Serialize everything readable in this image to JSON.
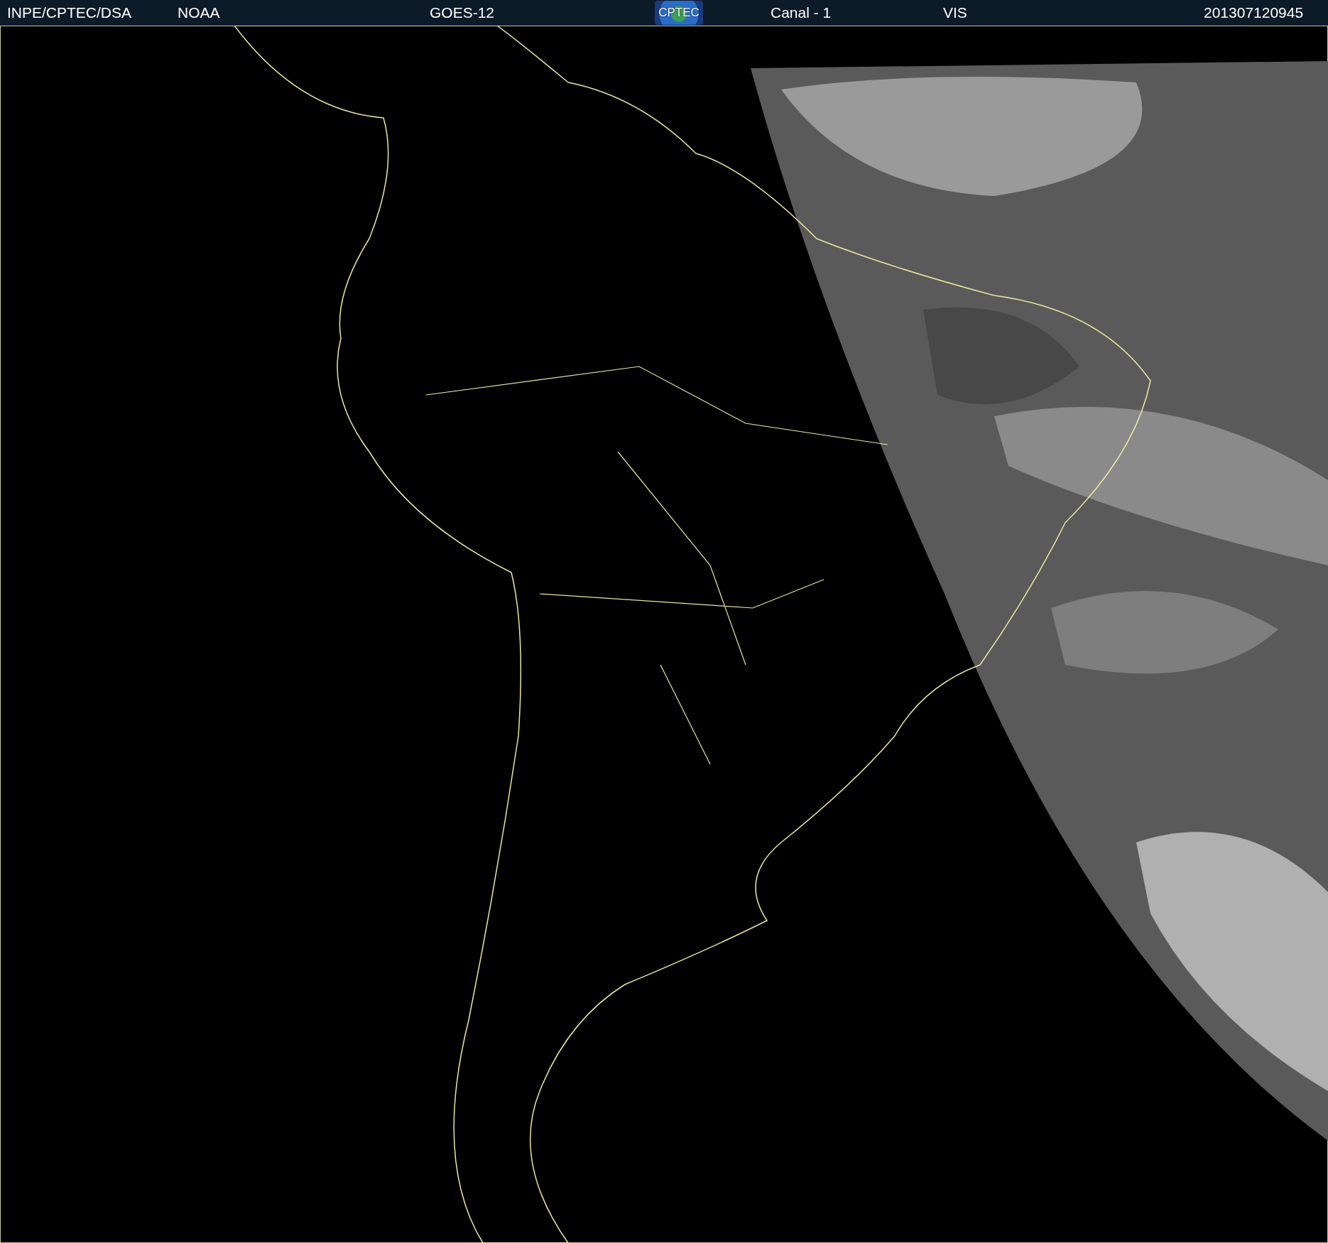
{
  "header": {
    "items": [
      {
        "kind": "text",
        "text": "INPE/CPTEC/DSA"
      },
      {
        "kind": "text",
        "text": "NOAA"
      },
      {
        "kind": "text",
        "text": "GOES-12"
      },
      {
        "kind": "logo",
        "text": "CPTEC"
      },
      {
        "kind": "text",
        "text": "Canal - 1"
      },
      {
        "kind": "text",
        "text": "VIS"
      },
      {
        "kind": "text",
        "text": "201307120945"
      }
    ]
  }
}
